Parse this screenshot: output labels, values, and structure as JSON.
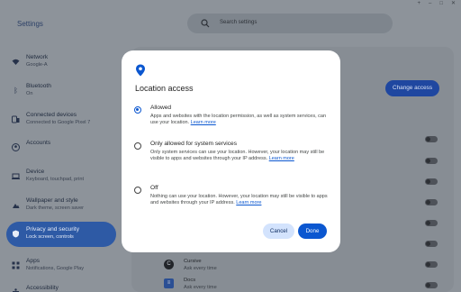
{
  "window": {
    "controls": [
      "+",
      "–",
      "□",
      "✕"
    ]
  },
  "app": {
    "title": "Settings"
  },
  "search": {
    "placeholder": "Search settings"
  },
  "sidebar": {
    "items": [
      {
        "label": "Network",
        "sub": "Google-A",
        "icon": "wifi-icon"
      },
      {
        "label": "Bluetooth",
        "sub": "On",
        "icon": "bluetooth-icon"
      },
      {
        "label": "Connected devices",
        "sub": "Connected to Google Pixel 7",
        "icon": "devices-icon"
      },
      {
        "label": "Accounts",
        "sub": "",
        "icon": "account-icon"
      },
      {
        "label": "Device",
        "sub": "Keyboard, touchpad, print",
        "icon": "laptop-icon"
      },
      {
        "label": "Wallpaper and style",
        "sub": "Dark theme, screen saver",
        "icon": "palette-icon"
      },
      {
        "label": "Privacy and security",
        "sub": "Lock screen, controls",
        "icon": "shield-icon",
        "active": true
      },
      {
        "label": "Apps",
        "sub": "Notifications, Google Play",
        "icon": "apps-icon"
      },
      {
        "label": "Accessibility",
        "sub": "",
        "icon": "accessibility-icon"
      }
    ]
  },
  "main": {
    "change_access_label": "Change access",
    "rows": [
      {
        "title": "Cursive",
        "sub": "Ask every time",
        "icon": "C"
      },
      {
        "title": "Docs",
        "sub": "Ask every time",
        "icon": "≡"
      }
    ]
  },
  "dialog": {
    "title": "Location access",
    "options": [
      {
        "label": "Allowed",
        "desc": "Apps and websites with the location permission, as well as system services, can use your location.",
        "link": "Learn more",
        "selected": true
      },
      {
        "label": "Only allowed for system services",
        "desc": "Only system services can use your location. However, your location may still be visible to apps and websites through your IP address.",
        "link": "Learn more",
        "selected": false
      },
      {
        "label": "Off",
        "desc": "Nothing can use your location. However, your location may still be visible to apps and websites through your IP address.",
        "link": "Learn more",
        "selected": false
      }
    ],
    "cancel_label": "Cancel",
    "done_label": "Done"
  },
  "colors": {
    "accent": "#0b57d0",
    "accent_container": "#d3e3fd"
  }
}
